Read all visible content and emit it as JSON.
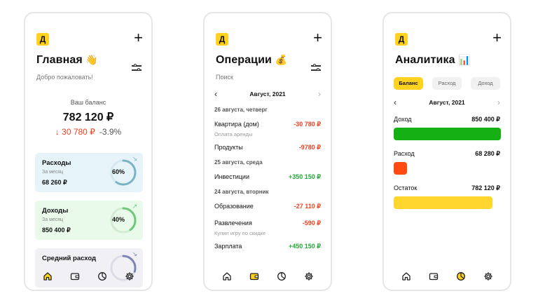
{
  "brand_letter": "Д",
  "plus_glyph": "+",
  "colors": {
    "accent": "#ffd21f",
    "expense": "#f0401f",
    "income": "#22a838",
    "expense_card": "#e6f4fa",
    "income_card": "#e9f9ea",
    "bar_income": "#14b014",
    "bar_expense": "#ff4a12",
    "bar_rest": "#ffd62e"
  },
  "home": {
    "title": "Главная",
    "title_emoji": "👋",
    "greeting": "Добро пожаловать!",
    "balance_label": "Ваш баланс",
    "balance_value": "782 120 ₽",
    "delta_value": "↓ 30 780 ₽",
    "delta_percent": "-3.9%",
    "cards": [
      {
        "title": "Расходы",
        "period": "За месяц",
        "value": "68 260 ₽",
        "percent": "60%",
        "progress": 0.6,
        "trend": "down"
      },
      {
        "title": "Доходы",
        "period": "За месяц",
        "value": "850 400 ₽",
        "percent": "40%",
        "progress": 0.4,
        "trend": "up"
      },
      {
        "title": "Средний расход",
        "period": "",
        "value": "",
        "percent": "",
        "progress": 0.3,
        "trend": "down"
      }
    ],
    "active_tab": 0
  },
  "operations": {
    "title": "Операции",
    "title_emoji": "💰",
    "search_placeholder": "Поиск",
    "month": "Август, 2021",
    "rows": [
      {
        "kind": "date",
        "label": "26 августа, четверг"
      },
      {
        "kind": "op",
        "label": "Квартира (дом)",
        "amount": "-30 780 ₽",
        "sign": "neg"
      },
      {
        "kind": "note",
        "label": "Оплата аренды"
      },
      {
        "kind": "op",
        "label": "Продукты",
        "amount": "-9780 ₽",
        "sign": "neg"
      },
      {
        "kind": "date",
        "label": "25 августа, среда"
      },
      {
        "kind": "op",
        "label": "Инвестиции",
        "amount": "+350 150 ₽",
        "sign": "pos"
      },
      {
        "kind": "date",
        "label": "24 августа, вторник"
      },
      {
        "kind": "op",
        "label": "Образование",
        "amount": "-27 110 ₽",
        "sign": "neg"
      },
      {
        "kind": "op",
        "label": "Развлечения",
        "amount": "-590 ₽",
        "sign": "neg"
      },
      {
        "kind": "note",
        "label": "Купил игру по скидке"
      },
      {
        "kind": "op",
        "label": "Зарплата",
        "amount": "+450 150 ₽",
        "sign": "pos"
      }
    ],
    "active_tab": 1
  },
  "analytics": {
    "title": "Аналитика",
    "title_emoji": "📊",
    "chips": [
      {
        "label": "Баланс",
        "active": true
      },
      {
        "label": "Расход",
        "active": false
      },
      {
        "label": "Доход",
        "active": false
      }
    ],
    "month": "Август, 2021",
    "rows": [
      {
        "label": "Доход",
        "value": "850 400 ₽",
        "share": 1.0,
        "color": "#14b014"
      },
      {
        "label": "Расход",
        "value": "68 280 ₽",
        "share": 0.08,
        "color": "#ff4a12"
      },
      {
        "label": "Остаток",
        "value": "782 120 ₽",
        "share": 0.92,
        "color": "#ffd62e"
      }
    ],
    "active_tab": 2
  },
  "tabs": [
    {
      "name": "home-icon"
    },
    {
      "name": "wallet-icon"
    },
    {
      "name": "chart-icon"
    },
    {
      "name": "settings-icon"
    }
  ]
}
